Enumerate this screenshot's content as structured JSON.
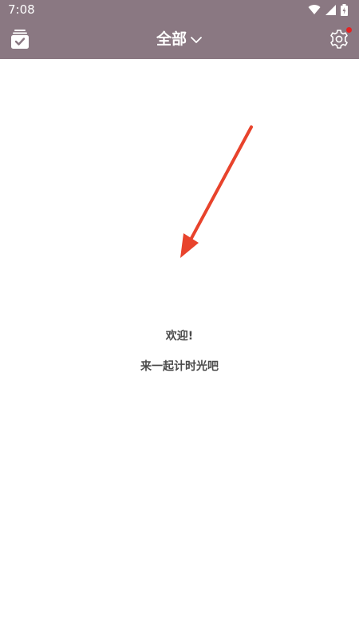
{
  "status_bar": {
    "time": "7:08",
    "icons": [
      "wifi-icon",
      "cellular-signal-icon",
      "battery-icon"
    ]
  },
  "app_bar": {
    "title": "全部",
    "left_icon": "calendar-check-icon",
    "right_icon": "gear-icon",
    "has_notification": true
  },
  "empty_state": {
    "welcome": "欢迎!",
    "message": "来一起计时光吧"
  },
  "colors": {
    "app_bar": "#8a7882",
    "arrow": "#e8432c",
    "notification_dot": "#e52222",
    "text": "#4a4a4a"
  }
}
